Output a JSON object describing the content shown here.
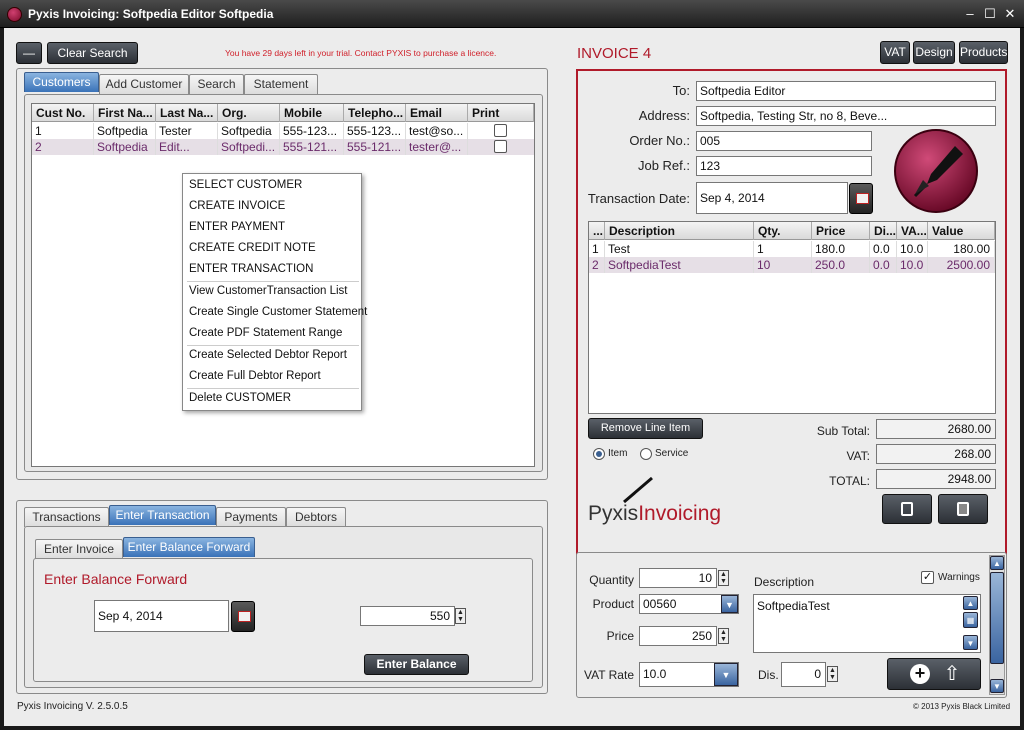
{
  "window": {
    "title": "Pyxis Invoicing: Softpedia Editor Softpedia",
    "min": "–",
    "max": "☐",
    "close": "✕"
  },
  "top": {
    "dash_label": "—",
    "clear_search": "Clear Search",
    "trial_notice": "You have 29 days left in your trial. Contact PYXIS to purchase a licence."
  },
  "customer_tabs": [
    "Customers",
    "Add Customer",
    "Search",
    "Statement"
  ],
  "customers": {
    "columns": [
      "Cust No.",
      "First Na...",
      "Last Na...",
      "Org.",
      "Mobile",
      "Telepho...",
      "Email",
      "Print"
    ],
    "rows": [
      [
        "1",
        "Softpedia",
        "Tester",
        "Softpedia",
        "555-123...",
        "555-123...",
        "test@so..."
      ],
      [
        "2",
        "Softpedia",
        "Edit...",
        "Softpedi...",
        "555-121...",
        "555-121...",
        "tester@..."
      ]
    ]
  },
  "context_menu": [
    "SELECT CUSTOMER",
    "CREATE INVOICE",
    "ENTER PAYMENT",
    "CREATE CREDIT NOTE",
    "ENTER TRANSACTION",
    "View CustomerTransaction List",
    "Create Single Customer Statement",
    "Create PDF Statement Range",
    "Create Selected Debtor Report",
    "Create Full Debtor Report",
    "Delete CUSTOMER"
  ],
  "trans_tabs": [
    "Transactions",
    "Enter Transaction",
    "Payments",
    "Debtors"
  ],
  "sub_tabs": [
    "Enter Invoice",
    "Enter Balance Forward"
  ],
  "balance": {
    "heading": "Enter Balance Forward",
    "date": "Sep 4, 2014",
    "amount": "550",
    "button": "Enter Balance"
  },
  "invoice": {
    "title": "INVOICE 4",
    "buttons": [
      "VAT",
      "Design",
      "Products"
    ],
    "labels": {
      "to": "To:",
      "address": "Address:",
      "order": "Order No.:",
      "job": "Job Ref.:",
      "tdate": "Transaction Date:"
    },
    "to": "Softpedia Editor",
    "address": "Softpedia, Testing Str, no 8, Beve...",
    "order": "005",
    "job": "123",
    "tdate": "Sep 4, 2014",
    "columns": [
      "...",
      "Description",
      "Qty.",
      "Price",
      "Di...",
      "VA...",
      "Value"
    ],
    "lines": [
      [
        "1",
        "Test",
        "1",
        "180.0",
        "0.0",
        "10.0",
        "180.00"
      ],
      [
        "2",
        "SoftpediaTest",
        "10",
        "250.0",
        "0.0",
        "10.0",
        "2500.00"
      ]
    ],
    "remove_button": "Remove Line Item",
    "radio_item": "Item",
    "radio_service": "Service",
    "subtotal_label": "Sub Total:",
    "subtotal": "2680.00",
    "vat_label": "VAT:",
    "vat": "268.00",
    "total_label": "TOTAL:",
    "total": "2948.00",
    "logo_pyxis": "Pyxis",
    "logo_invoicing": "Invoicing"
  },
  "item_entry": {
    "qty_label": "Quantity",
    "qty": "10",
    "product_label": "Product",
    "product": "00560",
    "price_label": "Price",
    "price": "250",
    "vat_label": "VAT Rate",
    "vat": "10.0",
    "dis_label": "Dis.",
    "dis": "0",
    "desc_label": "Description",
    "desc": "SoftpediaTest",
    "warnings_label": "Warnings"
  },
  "status": {
    "version": "Pyxis Invoicing V. 2.5.0.5",
    "copyright": "© 2013 Pyxis Black Limited"
  },
  "colors": {
    "accent_red": "#b01a2a",
    "selected_tab": "#3a72b8",
    "selected_row": "#e6dfe6"
  }
}
